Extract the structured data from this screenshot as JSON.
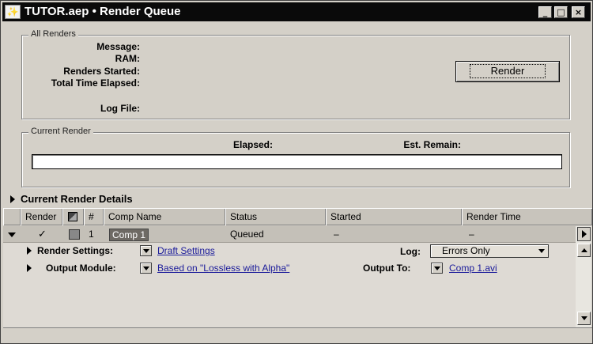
{
  "window": {
    "title": "TUTOR.aep • Render Queue",
    "icon_glyph": "✨",
    "buttons": {
      "minimize": "_",
      "maximize": "□",
      "close": "×"
    }
  },
  "all_renders": {
    "group_label": "All Renders",
    "fields": {
      "message": "Message:",
      "ram": "RAM:",
      "renders_started": "Renders Started:",
      "total_time_elapsed": "Total Time Elapsed:",
      "log_file": "Log File:"
    },
    "render_button": "Render"
  },
  "current_render": {
    "group_label": "Current Render",
    "elapsed_label": "Elapsed:",
    "est_remain_label": "Est. Remain:",
    "progress": 0
  },
  "details": {
    "label": "Current Render Details"
  },
  "columns": {
    "render": "Render",
    "label_icon": "label-color-icon",
    "number": "#",
    "comp_name": "Comp Name",
    "status": "Status",
    "started": "Started",
    "render_time": "Render Time"
  },
  "queue": {
    "items": [
      {
        "checked": "✓",
        "number": "1",
        "comp_name": "Comp 1",
        "status": "Queued",
        "started": "–",
        "render_time": "–",
        "render_settings_label": "Render Settings:",
        "render_settings_value": "Draft Settings",
        "log_label": "Log:",
        "log_value": "Errors Only",
        "output_module_label": "Output Module:",
        "output_module_value": "Based on \"Lossless with Alpha\"",
        "output_to_label": "Output To:",
        "output_to_value": "Comp 1.avi"
      }
    ]
  },
  "colors": {
    "titlebar": "#0a0a0a",
    "panel": "#d4d0c8",
    "link": "#1a1a9a",
    "selected_comp": "#6e6a64"
  }
}
